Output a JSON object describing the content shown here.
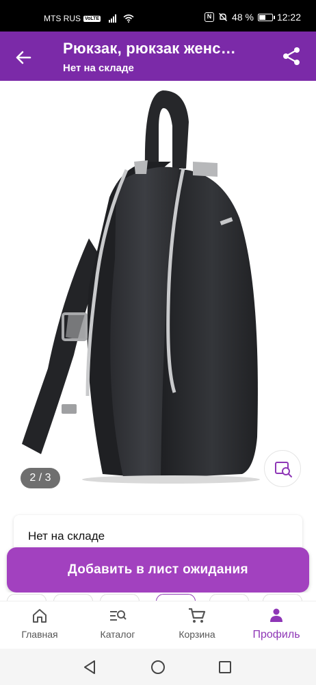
{
  "status_bar": {
    "carrier": "MTS RUS",
    "volte": "VoLTE",
    "battery": "48 %",
    "time": "12:22"
  },
  "app_bar": {
    "title": "Рюкзак, рюкзак женс…",
    "subtitle": "Нет на складе"
  },
  "gallery": {
    "counter": "2 / 3"
  },
  "stock": {
    "text": "Нет на складе"
  },
  "cta": {
    "label": "Добавить в лист ожидания"
  },
  "bottom_nav": {
    "items": [
      {
        "label": "Главная",
        "icon": "home-icon"
      },
      {
        "label": "Каталог",
        "icon": "catalog-search-icon"
      },
      {
        "label": "Корзина",
        "icon": "cart-icon"
      },
      {
        "label": "Профиль",
        "icon": "profile-icon",
        "active": true
      }
    ]
  },
  "colors": {
    "app_bar": "#7b2aa8",
    "cta": "#a241bf",
    "active_nav": "#8e36b6"
  }
}
